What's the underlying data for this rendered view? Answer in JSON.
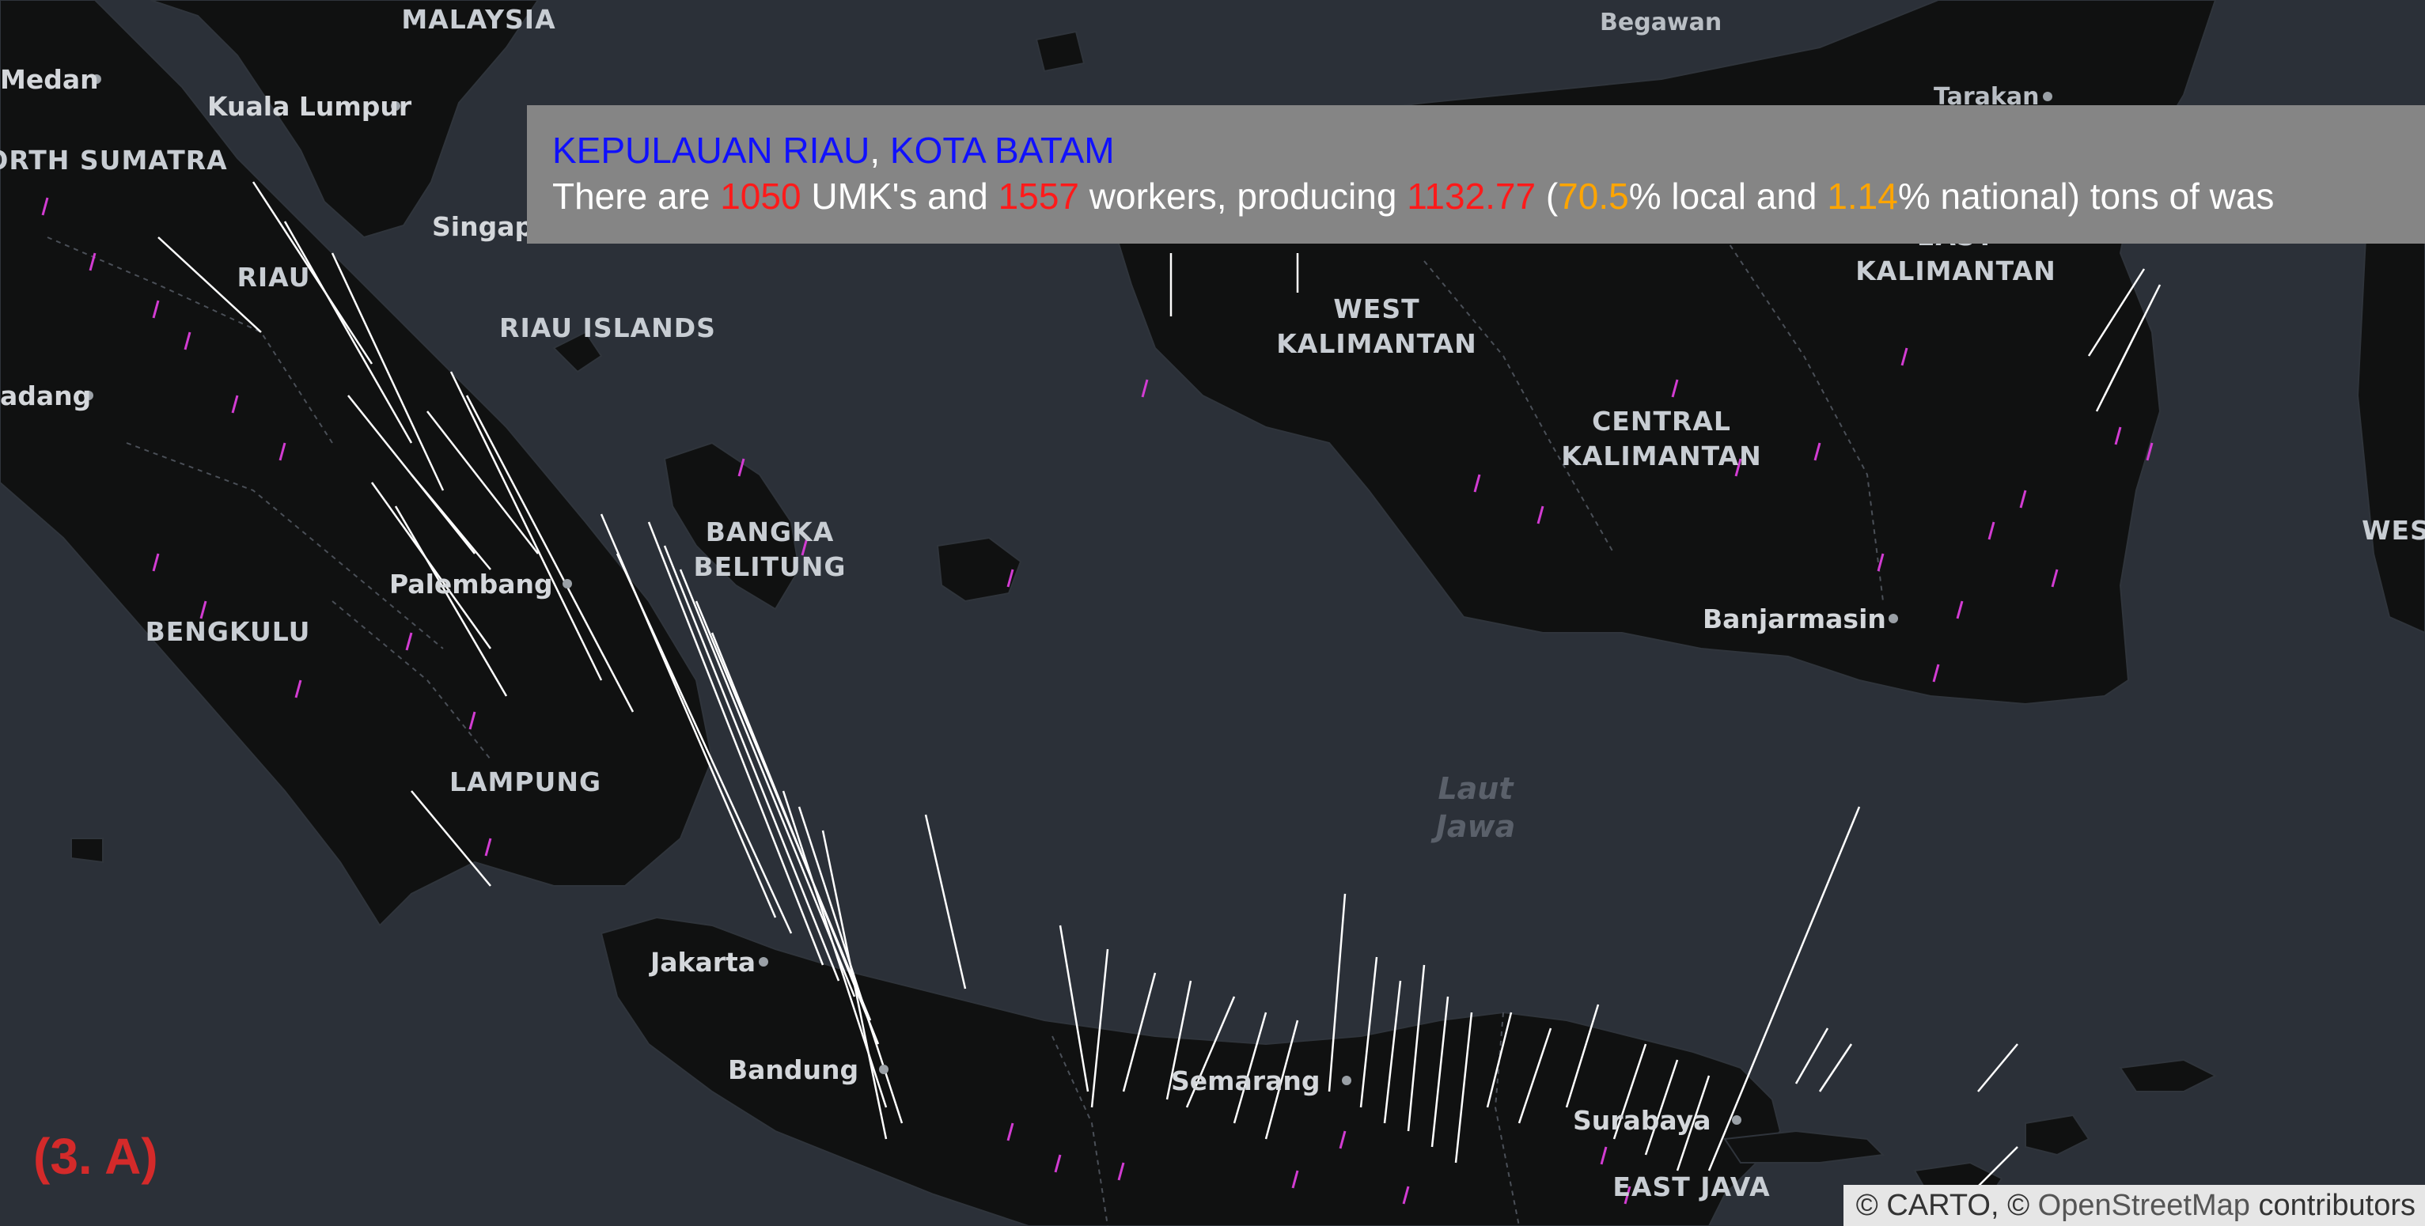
{
  "map": {
    "sea_label": [
      "Laut",
      "Jawa"
    ],
    "provinces": [
      {
        "id": "malaysia",
        "text": [
          "MALAYSIA"
        ]
      },
      {
        "id": "north-sumatra",
        "text": [
          "ORTH SUMATRA"
        ]
      },
      {
        "id": "riau",
        "text": [
          "RIAU"
        ]
      },
      {
        "id": "riau-islands",
        "text": [
          "RIAU ISLANDS"
        ]
      },
      {
        "id": "bengkulu",
        "text": [
          "BENGKULU"
        ]
      },
      {
        "id": "lampung",
        "text": [
          "LAMPUNG"
        ]
      },
      {
        "id": "bangka-belitung",
        "text": [
          "BANGKA",
          "BELITUNG"
        ]
      },
      {
        "id": "west-kalimantan",
        "text": [
          "WEST",
          "KALIMANTAN"
        ]
      },
      {
        "id": "central-kalimantan",
        "text": [
          "CENTRAL",
          "KALIMANTAN"
        ]
      },
      {
        "id": "east-kalimantan",
        "text": [
          "EAST",
          "KALIMANTAN"
        ]
      },
      {
        "id": "east-java",
        "text": [
          "EAST JAVA"
        ]
      },
      {
        "id": "wes",
        "text": [
          "WES"
        ]
      }
    ],
    "cities": [
      {
        "id": "medan",
        "text": "Medan"
      },
      {
        "id": "kuala-lumpur",
        "text": "Kuala Lumpur"
      },
      {
        "id": "singapore",
        "text": "Singapo"
      },
      {
        "id": "padang",
        "text": "adang"
      },
      {
        "id": "palembang",
        "text": "Palembang"
      },
      {
        "id": "jakarta",
        "text": "Jakarta"
      },
      {
        "id": "bandung",
        "text": "Bandung"
      },
      {
        "id": "semarang",
        "text": "Semarang"
      },
      {
        "id": "surabaya",
        "text": "Surabaya"
      },
      {
        "id": "banjarmasin",
        "text": "Banjarmasin"
      },
      {
        "id": "tarakan",
        "text": "Tarakan"
      },
      {
        "id": "begawan",
        "text": "Begawan"
      }
    ]
  },
  "tooltip": {
    "province": "KEPULAUAN RIAU",
    "separator": ", ",
    "city": "KOTA BATAM",
    "t1": "There are ",
    "umk_count": "1050",
    "t2": " UMK's and ",
    "workers": "1557",
    "t3": " workers, producing ",
    "tons": "1132.77",
    "t4": " (",
    "local_pct": "70.5",
    "t5": "% local and ",
    "national_pct": "1.14",
    "t6": "% national) tons of was"
  },
  "panel_label": "(3. A)",
  "attribution": {
    "prefix": "© CARTO, © ",
    "osm": "OpenStreetMap",
    "suffix": " contributors"
  },
  "colors": {
    "sea": "#2b3038",
    "land": "#101111",
    "column_white": "#ffffff",
    "column_magenta": "#d23cd2",
    "tooltip_bg": "#858585",
    "highlight_blue": "#1010ff",
    "highlight_red": "#ff1a1a",
    "highlight_orange": "#ffa500"
  }
}
